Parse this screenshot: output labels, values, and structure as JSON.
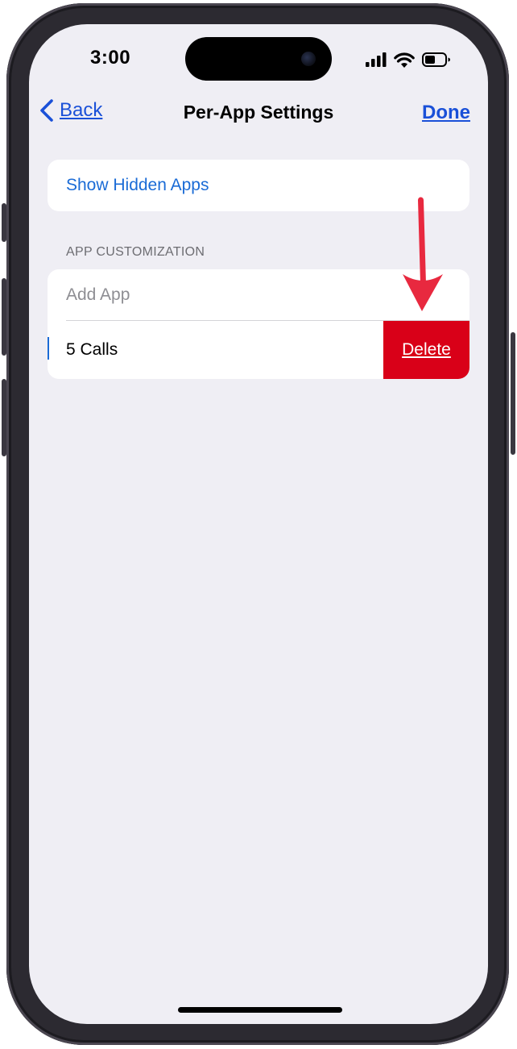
{
  "status_bar": {
    "time": "3:00"
  },
  "nav": {
    "back_label": "Back",
    "title": "Per-App Settings",
    "done_label": "Done"
  },
  "hidden_apps": {
    "label": "Show Hidden Apps"
  },
  "app_customization": {
    "section_header": "APP CUSTOMIZATION",
    "add_app_label": "Add App",
    "items": [
      {
        "label": "5 Calls",
        "delete_label": "Delete"
      }
    ]
  },
  "colors": {
    "accent": "#1a6bd6",
    "link_blue": "#1a50d8",
    "delete_red": "#d90018",
    "annotation_arrow": "#e8293f",
    "background": "#efeef4"
  },
  "icons": [
    "chevron-left-icon",
    "cellular-signal-icon",
    "wifi-icon",
    "battery-icon",
    "down-arrow-annotation"
  ]
}
